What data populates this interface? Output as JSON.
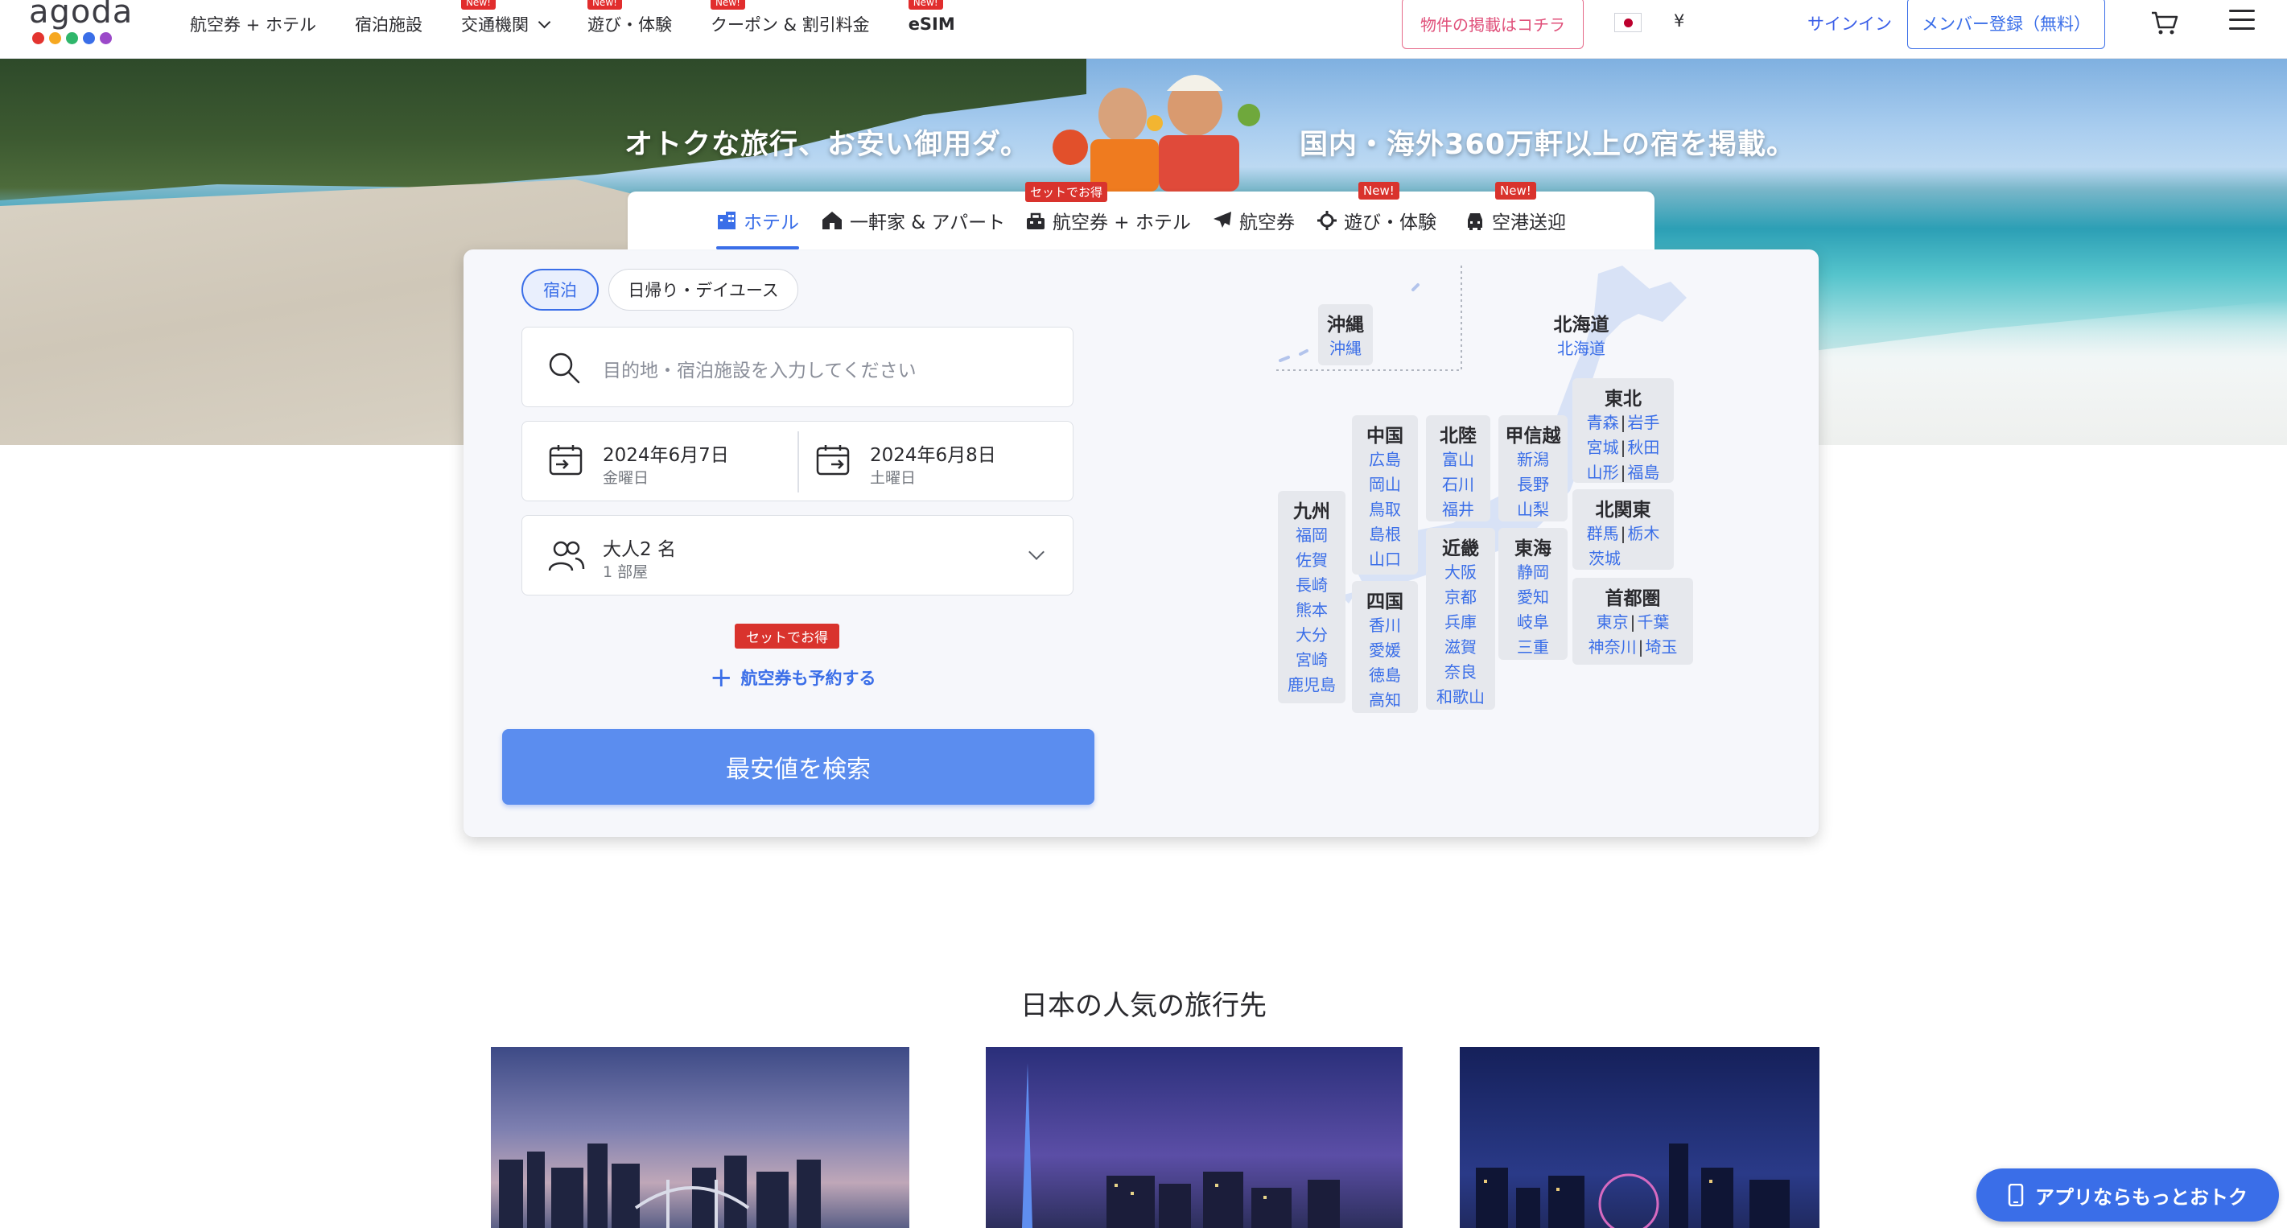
{
  "header": {
    "logo": "agoda",
    "logo_dot_colors": [
      "#e3342f",
      "#f6a821",
      "#2fb66b",
      "#3a6ee8",
      "#9b49c9"
    ],
    "nav": [
      {
        "label": "航空券 + ホテル",
        "tag": ""
      },
      {
        "label": "宿泊施設",
        "tag": ""
      },
      {
        "label": "交通機関",
        "tag": "New!"
      },
      {
        "label": "遊び・体験",
        "tag": "New!"
      },
      {
        "label": "クーポン & 割引料金",
        "tag": "New!"
      },
      {
        "label": "eSIM",
        "tag": "New!"
      }
    ],
    "list_property": "物件の掲載はコチラ",
    "currency": "¥",
    "signin": "サインイン",
    "signup": "メンバー登録（無料）"
  },
  "hero": {
    "tagline_left": "オトクな旅行、お安い御用ダ。",
    "tagline_right": "国内・海外360万軒以上の宿を掲載。"
  },
  "tabs": [
    {
      "label": "ホテル",
      "tag": "",
      "icon": "hotel-icon",
      "active": true
    },
    {
      "label": "一軒家 & アパート",
      "tag": "",
      "icon": "house-icon"
    },
    {
      "label": "航空券 + ホテル",
      "tag": "セットでお得",
      "icon": "bundle-icon"
    },
    {
      "label": "航空券",
      "tag": "",
      "icon": "plane-icon"
    },
    {
      "label": "遊び・体験",
      "tag": "New!",
      "icon": "activity-icon"
    },
    {
      "label": "空港送迎",
      "tag": "New!",
      "icon": "transfer-icon"
    }
  ],
  "search": {
    "stay_types": [
      "宿泊",
      "日帰り・デイユース"
    ],
    "placeholder": "目的地・宿泊施設を入力してください",
    "checkin": {
      "date": "2024年6月7日",
      "weekday": "金曜日"
    },
    "checkout": {
      "date": "2024年6月8日",
      "weekday": "土曜日"
    },
    "guests": {
      "adults": "大人2 名",
      "rooms": "1 部屋"
    },
    "bundle_tag": "セットでお得",
    "add_flight": "航空券も予約する",
    "submit": "最安値を検索"
  },
  "map": {
    "okinawa": {
      "name": "沖縄",
      "prefs": [
        "沖縄"
      ]
    },
    "hokkaido": {
      "name": "北海道",
      "prefs": [
        "北海道"
      ]
    },
    "tohoku": {
      "name": "東北",
      "rows": [
        [
          "青森",
          "岩手"
        ],
        [
          "宮城",
          "秋田"
        ],
        [
          "山形",
          "福島"
        ]
      ]
    },
    "kitakanto": {
      "name": "北関東",
      "rows": [
        [
          "群馬",
          "栃木"
        ],
        [
          "茨城"
        ]
      ]
    },
    "shutoken": {
      "name": "首都圏",
      "rows": [
        [
          "東京",
          "千葉"
        ],
        [
          "神奈川",
          "埼玉"
        ]
      ]
    },
    "koshinetsu": {
      "name": "甲信越",
      "prefs": [
        "新潟",
        "長野",
        "山梨"
      ]
    },
    "tokai": {
      "name": "東海",
      "prefs": [
        "静岡",
        "愛知",
        "岐阜",
        "三重"
      ]
    },
    "hokuriku": {
      "name": "北陸",
      "prefs": [
        "富山",
        "石川",
        "福井"
      ]
    },
    "kinki": {
      "name": "近畿",
      "prefs": [
        "大阪",
        "京都",
        "兵庫",
        "滋賀",
        "奈良",
        "和歌山"
      ]
    },
    "chugoku": {
      "name": "中国",
      "prefs": [
        "広島",
        "岡山",
        "鳥取",
        "島根",
        "山口"
      ]
    },
    "shikoku": {
      "name": "四国",
      "prefs": [
        "香川",
        "愛媛",
        "徳島",
        "高知"
      ]
    },
    "kyushu": {
      "name": "九州",
      "prefs": [
        "福岡",
        "佐賀",
        "長崎",
        "熊本",
        "大分",
        "宮崎",
        "鹿児島"
      ]
    }
  },
  "popular": {
    "title": "日本の人気の旅行先"
  },
  "app_promo": "アプリならもっとおトク"
}
